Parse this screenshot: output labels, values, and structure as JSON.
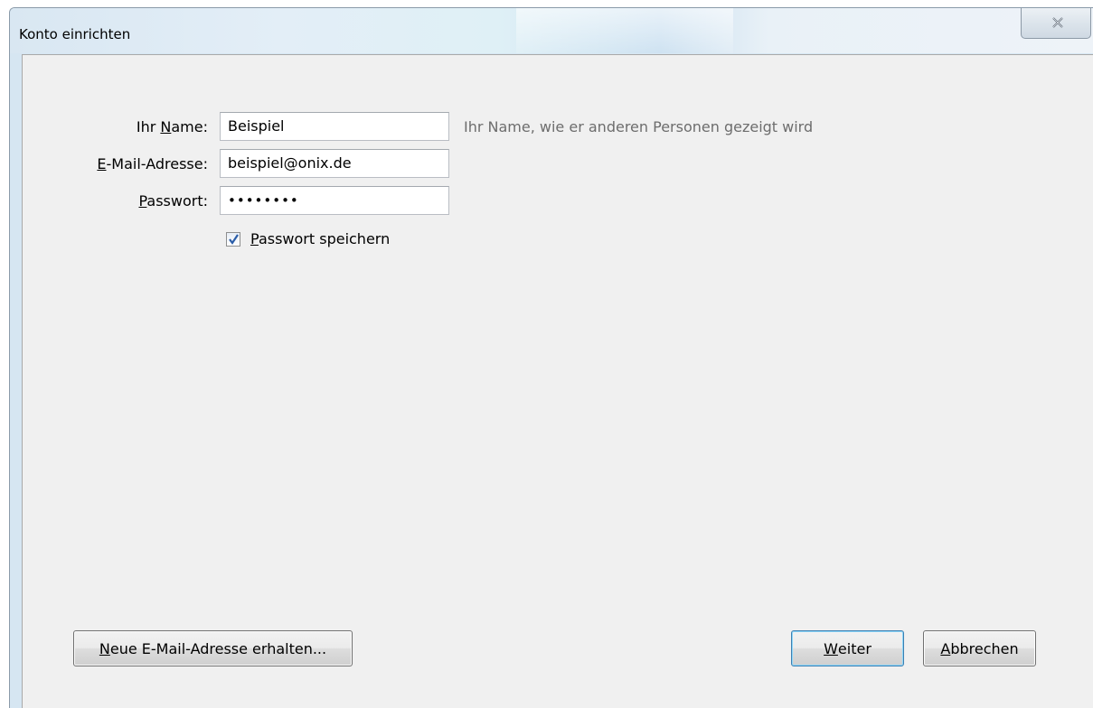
{
  "window": {
    "title": "Konto einrichten"
  },
  "form": {
    "name": {
      "label_pre": "Ihr ",
      "label_accel": "N",
      "label_post": "ame:",
      "value": "Beispiel",
      "hint": "Ihr Name, wie er anderen Personen gezeigt wird"
    },
    "email": {
      "label_pre": "",
      "label_accel": "E",
      "label_post": "-Mail-Adresse:",
      "value": "beispiel@onix.de"
    },
    "password": {
      "label_pre": "",
      "label_accel": "P",
      "label_post": "asswort:",
      "value": "••••••••"
    },
    "remember": {
      "label_accel": "P",
      "label_post": "asswort speichern",
      "checked": true
    }
  },
  "buttons": {
    "new_email": {
      "accel": "N",
      "rest": "eue E-Mail-Adresse erhalten..."
    },
    "next": {
      "accel": "W",
      "rest": "eiter"
    },
    "cancel": {
      "accel": "A",
      "rest": "bbrechen"
    }
  },
  "icons": {
    "close": "close-icon",
    "check": "checkmark-icon"
  },
  "colors": {
    "accent": "#3c7fb1",
    "hint_text": "#6d6d6d",
    "checkmark": "#2a5da8"
  }
}
